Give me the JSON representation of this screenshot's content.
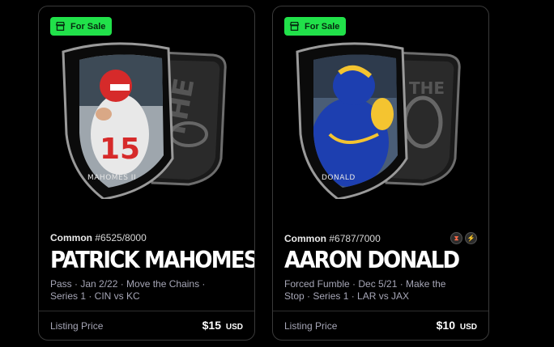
{
  "cards": [
    {
      "badge": "For Sale",
      "art_caption": "MAHOMES II",
      "tier": "Common",
      "serial": "#6525/8000",
      "player": "PATRICK MAHOMES II",
      "details": "Pass · Jan 2/22 · Move the Chains · Series 1 · CIN vs KC",
      "price_label": "Listing Price",
      "price": "$15",
      "currency": "USD",
      "colors": {
        "jersey": "#e8e8e8",
        "helmet": "#d62a2a",
        "accent": "#f4c430"
      }
    },
    {
      "badge": "For Sale",
      "art_caption": "DONALD",
      "tier": "Common",
      "serial": "#6787/7000",
      "player": "AARON DONALD",
      "details": "Forced Fumble · Dec 5/21 · Make the Stop · Series 1 · LAR vs JAX",
      "price_label": "Listing Price",
      "price": "$10",
      "currency": "USD",
      "icons": [
        "hourglass-icon",
        "lightning-icon"
      ],
      "colors": {
        "jersey": "#1d3fb0",
        "helmet": "#1d3fb0",
        "accent": "#f4c430"
      }
    }
  ],
  "accent": "#21e14a"
}
